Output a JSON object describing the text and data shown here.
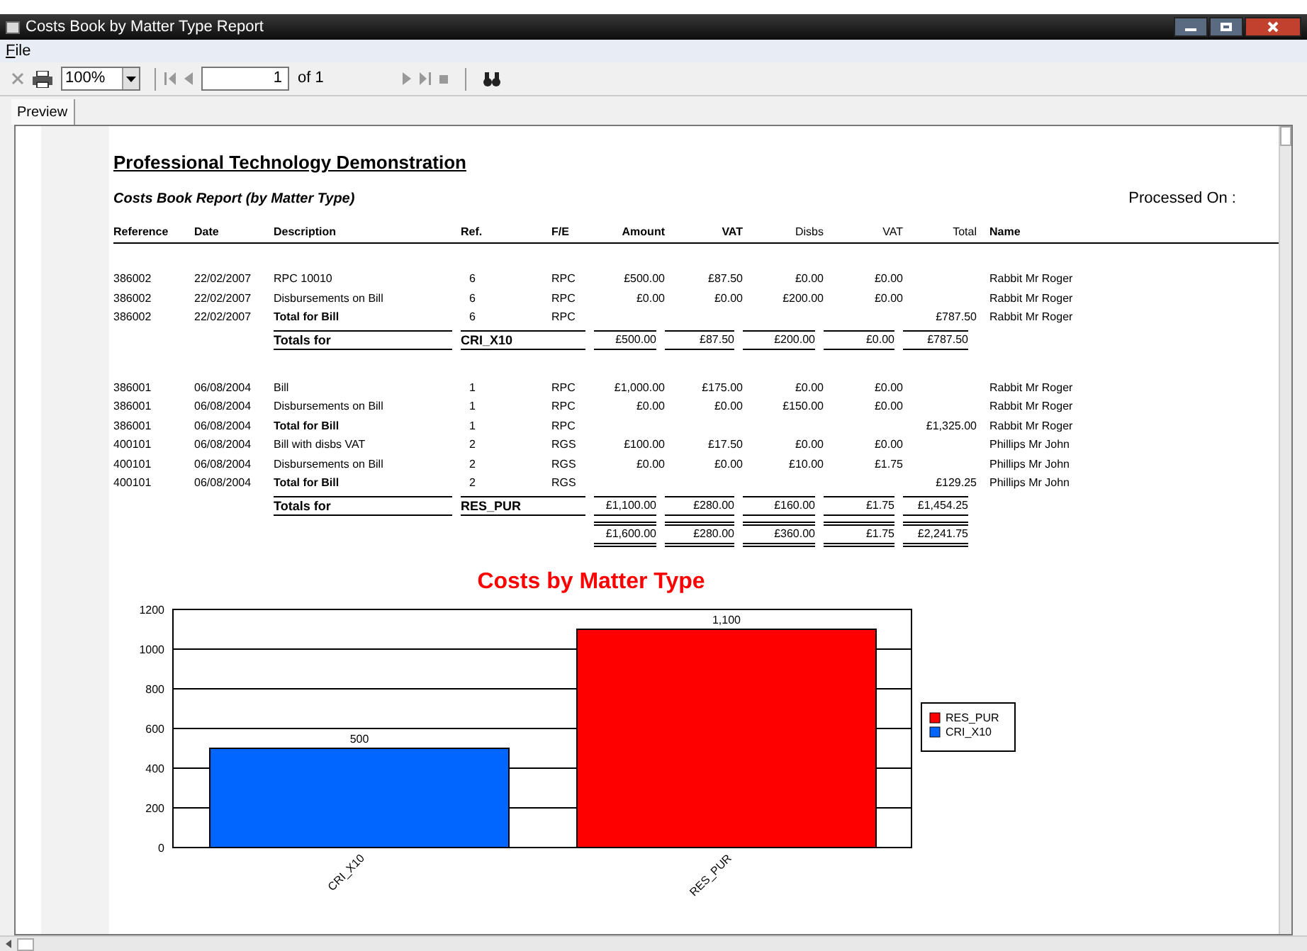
{
  "window": {
    "title": "Costs Book by Matter Type Report"
  },
  "menu": [
    {
      "label": "File"
    }
  ],
  "toolbar": {
    "zoom": "100%",
    "page": "1",
    "page_of": "of 1"
  },
  "tabs": [
    {
      "label": "Preview",
      "selected": true
    }
  ],
  "report": {
    "company": "Professional Technology Demonstration",
    "subtitle": "Costs Book Report (by Matter Type)",
    "processed_on": "Processed On :",
    "columns": [
      "Reference",
      "Date",
      "Description",
      "Ref.",
      "F/E",
      "Amount",
      "VAT",
      "Disbs",
      "VAT",
      "Total",
      "Name"
    ],
    "groups": [
      {
        "rows": [
          {
            "kind": "line",
            "reference": "386002",
            "date": "22/02/2007",
            "description": "RPC 10010",
            "ref": "6",
            "fe": "RPC",
            "amount": "£500.00",
            "vat": "£87.50",
            "disbs": "£0.00",
            "disbs_vat": "£0.00",
            "name": "Rabbit Mr Roger"
          },
          {
            "kind": "line",
            "reference": "386002",
            "date": "22/02/2007",
            "description": "Disbursements on Bill",
            "ref": "6",
            "fe": "RPC",
            "amount": "£0.00",
            "vat": "£0.00",
            "disbs": "£200.00",
            "disbs_vat": "£0.00",
            "name": "Rabbit Mr Roger"
          },
          {
            "kind": "bill_total",
            "reference": "386002",
            "date": "22/02/2007",
            "description": "Total for Bill",
            "ref": "6",
            "fe": "RPC",
            "total": "£787.50",
            "name": "Rabbit Mr Roger"
          }
        ],
        "totals": {
          "label": "Totals for",
          "type": "CRI_X10",
          "amount": "£500.00",
          "vat": "£87.50",
          "disbs": "£200.00",
          "disbs_vat": "£0.00",
          "total": "£787.50"
        }
      },
      {
        "rows": [
          {
            "kind": "line",
            "reference": "386001",
            "date": "06/08/2004",
            "description": "Bill",
            "ref": "1",
            "fe": "RPC",
            "amount": "£1,000.00",
            "vat": "£175.00",
            "disbs": "£0.00",
            "disbs_vat": "£0.00",
            "name": "Rabbit Mr Roger"
          },
          {
            "kind": "line",
            "reference": "386001",
            "date": "06/08/2004",
            "description": "Disbursements on Bill",
            "ref": "1",
            "fe": "RPC",
            "amount": "£0.00",
            "vat": "£0.00",
            "disbs": "£150.00",
            "disbs_vat": "£0.00",
            "name": "Rabbit Mr Roger"
          },
          {
            "kind": "bill_total",
            "reference": "386001",
            "date": "06/08/2004",
            "description": "Total for Bill",
            "ref": "1",
            "fe": "RPC",
            "total": "£1,325.00",
            "name": "Rabbit Mr Roger"
          },
          {
            "kind": "line",
            "reference": "400101",
            "date": "06/08/2004",
            "description": "Bill with disbs VAT",
            "ref": "2",
            "fe": "RGS",
            "amount": "£100.00",
            "vat": "£17.50",
            "disbs": "£0.00",
            "disbs_vat": "£0.00",
            "name": "Phillips Mr John"
          },
          {
            "kind": "line",
            "reference": "400101",
            "date": "06/08/2004",
            "description": "Disbursements on Bill",
            "ref": "2",
            "fe": "RGS",
            "amount": "£0.00",
            "vat": "£0.00",
            "disbs": "£10.00",
            "disbs_vat": "£1.75",
            "name": "Phillips Mr John"
          },
          {
            "kind": "bill_total",
            "reference": "400101",
            "date": "06/08/2004",
            "description": "Total for Bill",
            "ref": "2",
            "fe": "RGS",
            "total": "£129.25",
            "name": "Phillips Mr John"
          }
        ],
        "totals": {
          "label": "Totals for",
          "type": "RES_PUR",
          "amount": "£1,100.00",
          "vat": "£280.00",
          "disbs": "£160.00",
          "disbs_vat": "£1.75",
          "total": "£1,454.25"
        }
      }
    ],
    "grand_total": {
      "amount": "£1,600.00",
      "vat": "£280.00",
      "disbs": "£360.00",
      "disbs_vat": "£1.75",
      "total": "£2,241.75"
    },
    "chart_data": {
      "type": "bar",
      "title": "Costs by Matter Type",
      "categories": [
        "CRI_X10",
        "RES_PUR"
      ],
      "series": [
        {
          "name": "RES_PUR",
          "color": "#ff0000",
          "values": [
            null,
            1100
          ]
        },
        {
          "name": "CRI_X10",
          "color": "#0066ff",
          "values": [
            500,
            null
          ]
        }
      ],
      "ylim": [
        0,
        1200
      ],
      "yticks": [
        0,
        200,
        400,
        600,
        800,
        1000,
        1200
      ],
      "grid": true,
      "legend": true,
      "value_labels": [
        "500",
        "1,100"
      ]
    }
  }
}
